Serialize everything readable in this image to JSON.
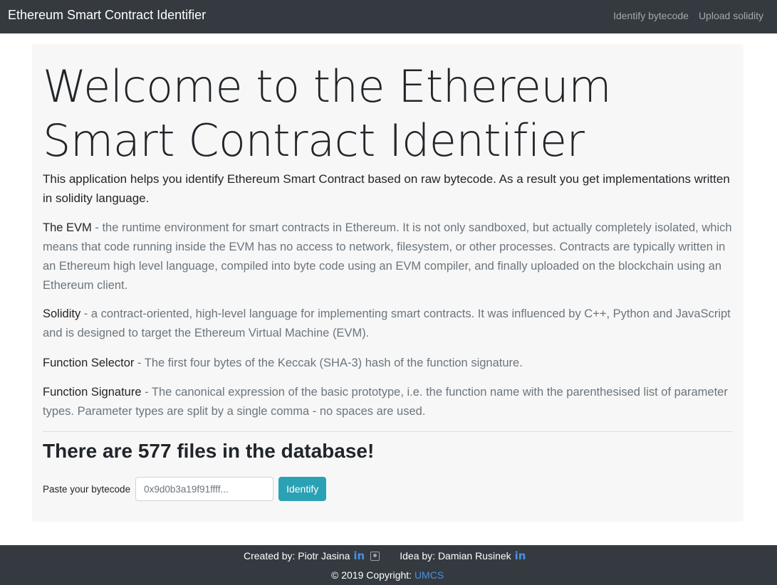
{
  "navbar": {
    "brand": "Ethereum Smart Contract Identifier",
    "links": [
      "Identify bytecode",
      "Upload solidity"
    ]
  },
  "main": {
    "heading": "Welcome to the Ethereum Smart Contract Identifier",
    "lead": "This application helps you identify Ethereum Smart Contract based on raw bytecode. As a result you get implementations written in solidity language.",
    "definitions": [
      {
        "term": "The EVM",
        "text": " - the runtime environment for smart contracts in Ethereum. It is not only sandboxed, but actually completely isolated, which means that code running inside the EVM has no access to network, filesystem, or other processes. Contracts are typically written in an Ethereum high level language, compiled into byte code using an EVM compiler, and finally uploaded on the blockchain using an Ethereum client."
      },
      {
        "term": "Solidity",
        "text": " - a contract-oriented, high-level language for implementing smart contracts. It was influenced by C++, Python and JavaScript and is designed to target the Ethereum Virtual Machine (EVM)."
      },
      {
        "term": "Function Selector",
        "text": " - The first four bytes of the Keccak (SHA-3) hash of the function signature."
      },
      {
        "term": "Function Signature",
        "text": " - The canonical expression of the basic prototype, i.e. the function name with the parenthesised list of parameter types. Parameter types are split by a single comma - no spaces are used."
      }
    ],
    "file_count": "There are 577 files in the database!",
    "form": {
      "label": "Paste your bytecode",
      "placeholder": "0x9d0b3a19f91ffff...",
      "button": "Identify"
    }
  },
  "footer": {
    "created_by": "Created by: Piotr Jasina",
    "idea_by": "Idea by: Damian Rusinek",
    "linkedin_glyph": "in",
    "copyright": "© 2019 Copyright: ",
    "org": "UMCS",
    "colors": {
      "link": "#4a90e2",
      "button": "#2aa1b4",
      "navbar": "#343a40"
    }
  }
}
